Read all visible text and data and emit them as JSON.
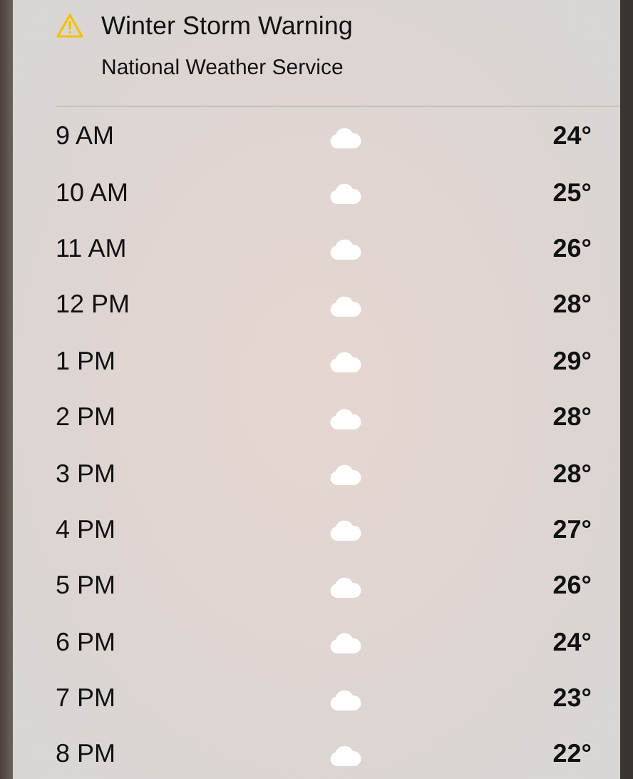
{
  "alert": {
    "title": "Winter Storm Warning",
    "source": "National Weather Service"
  },
  "hours": [
    {
      "time": "9 AM",
      "temp": "24°"
    },
    {
      "time": "10 AM",
      "temp": "25°"
    },
    {
      "time": "11 AM",
      "temp": "26°"
    },
    {
      "time": "12 PM",
      "temp": "28°"
    },
    {
      "time": "1 PM",
      "temp": "29°"
    },
    {
      "time": "2 PM",
      "temp": "28°"
    },
    {
      "time": "3 PM",
      "temp": "28°"
    },
    {
      "time": "4 PM",
      "temp": "27°"
    },
    {
      "time": "5 PM",
      "temp": "26°"
    },
    {
      "time": "6 PM",
      "temp": "24°"
    },
    {
      "time": "7 PM",
      "temp": "23°"
    },
    {
      "time": "8 PM",
      "temp": "22°"
    }
  ]
}
